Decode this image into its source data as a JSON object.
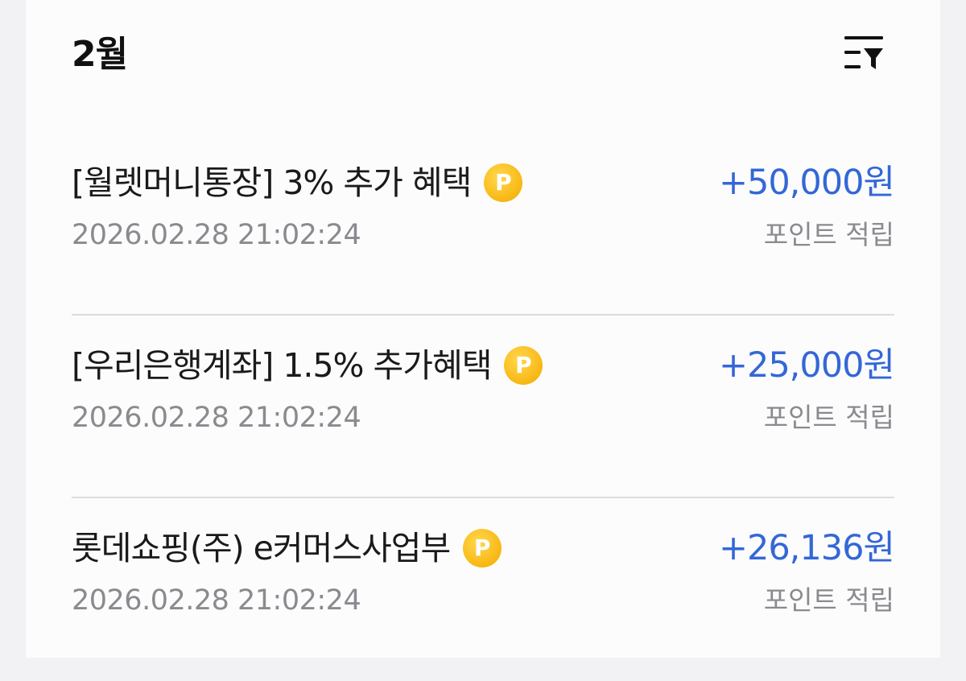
{
  "header": {
    "month_label": "2월",
    "filter_icon": "sort-filter-icon"
  },
  "transactions": [
    {
      "title": "[월렛머니통장] 3% 추가 혜택",
      "badge": "P",
      "badge_icon": "point-coin-icon",
      "datetime": "2026.02.28 21:02:24",
      "amount": "+50,000원",
      "type": "포인트 적립"
    },
    {
      "title": "[우리은행계좌] 1.5% 추가혜택",
      "badge": "P",
      "badge_icon": "point-coin-icon",
      "datetime": "2026.02.28 21:02:24",
      "amount": "+25,000원",
      "type": "포인트 적립"
    },
    {
      "title": "롯데쇼핑(주) e커머스사업부",
      "badge": "P",
      "badge_icon": "point-coin-icon",
      "datetime": "2026.02.28 21:02:24",
      "amount": "+26,136원",
      "type": "포인트 적립"
    }
  ],
  "colors": {
    "amount": "#3467d6",
    "secondary_text": "#8a8a8f",
    "primary_text": "#1a1a1a",
    "badge": "#f8b714",
    "background": "#f2f2f4",
    "card": "#fcfcfd"
  }
}
